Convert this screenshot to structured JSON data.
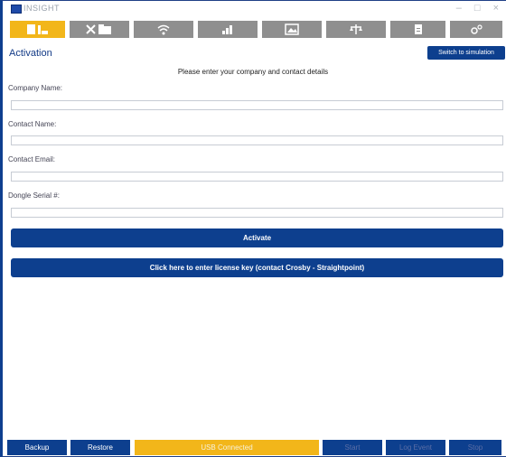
{
  "window": {
    "title": "INSIGHT",
    "minimize": "–",
    "maximize": "□",
    "close": "×"
  },
  "toolbar": {
    "tabs": [
      {
        "icon": "id-card-icon",
        "active": true
      },
      {
        "icon": "tools-folder-icon",
        "active": false
      },
      {
        "icon": "wifi-icon",
        "active": false
      },
      {
        "icon": "bar-chart-icon",
        "active": false
      },
      {
        "icon": "image-icon",
        "active": false
      },
      {
        "icon": "balance-scale-icon",
        "active": false
      },
      {
        "icon": "document-icon",
        "active": false
      },
      {
        "icon": "gears-icon",
        "active": false
      }
    ],
    "active_color": "#f2b61a",
    "inactive_color": "#8f8f8f"
  },
  "header": {
    "page_title": "Activation",
    "simulation_button": "Switch to simulation"
  },
  "form": {
    "instruction": "Please enter your company and contact details",
    "company_label": "Company Name:",
    "company_value": "",
    "contact_label": "Contact Name:",
    "contact_value": "",
    "email_label": "Contact Email:",
    "email_value": "",
    "serial_label": "Dongle Serial #:",
    "serial_value": "",
    "activate_button": "Activate",
    "license_button": "Click here to enter license key (contact Crosby - Straightpoint)"
  },
  "footer": {
    "backup": "Backup",
    "restore": "Restore",
    "status": "USB Connected",
    "start": "Start",
    "log_event": "Log Event",
    "stop": "Stop"
  },
  "colors": {
    "primary": "#0d3f8e",
    "accent": "#f2b61a"
  }
}
